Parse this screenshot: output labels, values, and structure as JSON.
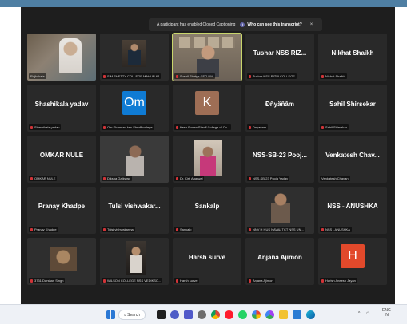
{
  "banner": {
    "message": "A participant has enabled Closed Captioning",
    "link": "Who can see this transcript?",
    "close": "×"
  },
  "tiles": [
    {
      "name": "",
      "tag": "Rajkokala",
      "kind": "video"
    },
    {
      "name": "",
      "tag": "S.M SHETTY COLLEGE MAHUR 64",
      "kind": "video"
    },
    {
      "name": "",
      "tag": "Sushil Shetye CEO NM",
      "kind": "video",
      "active": true
    },
    {
      "name": "Tushar NSS RIZ...",
      "tag": "Tushar NSS RIZVI COLLEGE",
      "kind": "name"
    },
    {
      "name": "Nikhat Shaikh",
      "tag": "Nikhat Shaikh",
      "kind": "name"
    },
    {
      "name": "Shashikala yadav",
      "tag": "Shashikala yadav",
      "kind": "name"
    },
    {
      "name": "",
      "tag": "Om Shamrao kes Shroff college",
      "kind": "avatar",
      "initials": "Om",
      "color": "#0f7bd4"
    },
    {
      "name": "",
      "tag": "Kesh Rosen Shroff College of Co...",
      "kind": "avatar",
      "initials": "K",
      "color": "#9e6e55"
    },
    {
      "name": "Đňyäňâm",
      "tag": "Dnyaňam",
      "kind": "name"
    },
    {
      "name": "Sahil Shirsekar",
      "tag": "Sahil Shirsekar",
      "kind": "name"
    },
    {
      "name": "OMKAR NULE",
      "tag": "OMKAR NULE",
      "kind": "name"
    },
    {
      "name": "",
      "tag": "Diksha Gaikwad",
      "kind": "video"
    },
    {
      "name": "",
      "tag": "Dr. Kirti Agarwal",
      "kind": "video"
    },
    {
      "name": "NSS-SB-23 Pooj...",
      "tag": "NSS-SB-23 Pooja Yadav",
      "kind": "name"
    },
    {
      "name": "Venkatesh Chav...",
      "tag": "Venkatesh Chavan",
      "kind": "name"
    },
    {
      "name": "Pranay Khadpe",
      "tag": "Pranay Khadpe",
      "kind": "name"
    },
    {
      "name": "Tulsi vishwakar...",
      "tag": "Tulsi vishwakarma",
      "kind": "name"
    },
    {
      "name": "Sankalp",
      "tag": "Sankalp",
      "kind": "name"
    },
    {
      "name": "",
      "tag": "NNV H HUS NAVAL TCT NSS UN...",
      "kind": "video"
    },
    {
      "name": "NSS - ANUSHKA",
      "tag": "NSS - ANUSHKA",
      "kind": "name"
    },
    {
      "name": "",
      "tag": "3731 Darshan Singh",
      "kind": "video"
    },
    {
      "name": "",
      "tag": "WILSON COLLEGE NSS VEDIKSO...",
      "kind": "video"
    },
    {
      "name": "Harsh surve",
      "tag": "Harsh surve",
      "kind": "name"
    },
    {
      "name": "Anjana Ajimon",
      "tag": "Anjana Ajimon",
      "kind": "name"
    },
    {
      "name": "",
      "tag": "Harish Aneesh Jayan",
      "kind": "avatar",
      "initials": "H",
      "color": "#e2492b"
    }
  ],
  "taskbar": {
    "search": "Search",
    "lang": "ENG",
    "region": "IN"
  }
}
